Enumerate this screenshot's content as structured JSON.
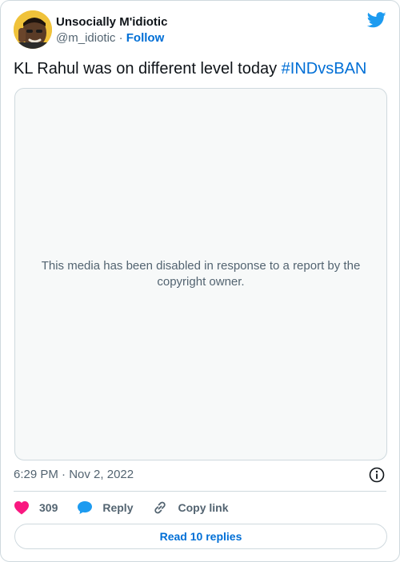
{
  "author": {
    "display_name": "Unsocially M'idiotic",
    "handle": "@m_idiotic",
    "separator": "·",
    "follow_label": "Follow"
  },
  "tweet": {
    "text": "KL Rahul was on different level today ",
    "hashtag": "#INDvsBAN"
  },
  "media": {
    "message": "This media has been disabled in response to a report by the copyright owner."
  },
  "meta": {
    "time": "6:29 PM",
    "separator": "·",
    "date": "Nov 2, 2022"
  },
  "actions": {
    "likes_count": "309",
    "reply_label": "Reply",
    "copy_link_label": "Copy link"
  },
  "footer": {
    "read_replies_label": "Read 10 replies"
  },
  "icons": {
    "brand": "twitter-bird-icon",
    "like": "heart-icon",
    "reply": "speech-bubble-icon",
    "copy": "link-icon",
    "info": "info-icon"
  },
  "colors": {
    "brand_blue": "#1d9bf0",
    "link_blue": "#006fd6",
    "like_pink": "#f91880",
    "muted_text": "#536471",
    "border": "#cfd9de"
  }
}
